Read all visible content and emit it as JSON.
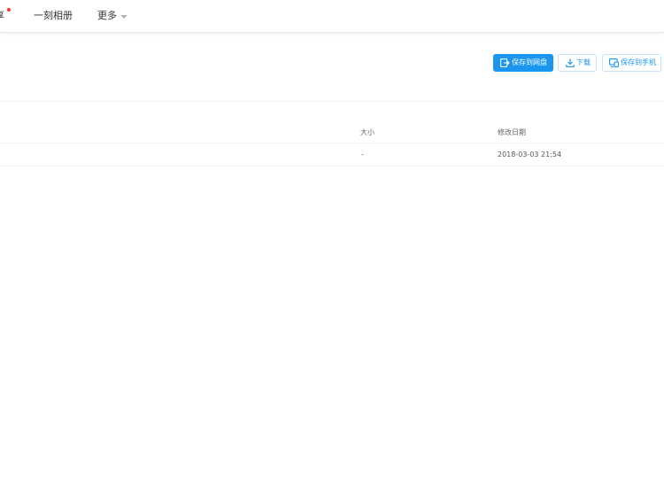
{
  "topnav": {
    "share_label": "享",
    "album_label": "一刻相册",
    "more_label": "更多"
  },
  "toolbar": {
    "save_to_cloud_label": "保存到网盘",
    "download_label": "下载",
    "save_to_phone_label": "保存到手机",
    "accent_color": "#1a95f0"
  },
  "file_table": {
    "columns": [
      {
        "label": "大小"
      },
      {
        "label": "修改日期"
      }
    ],
    "rows": [
      {
        "size": "-",
        "modified": "2018-03-03 21:54"
      }
    ]
  },
  "icons": {
    "save_to_cloud": "save-to-cloud-icon",
    "download": "download-icon",
    "save_to_phone": "phone-icon",
    "more_caret": "chevron-down-icon",
    "notification": "red-dot-badge"
  }
}
